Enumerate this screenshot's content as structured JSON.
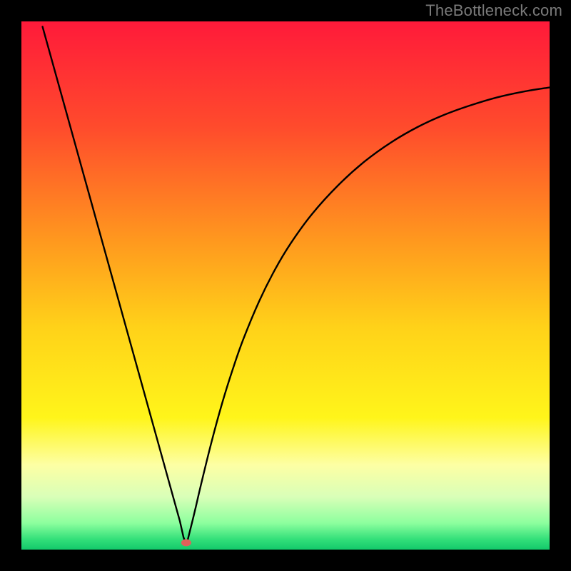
{
  "attribution": "TheBottleneck.com",
  "chart_data": {
    "type": "line",
    "title": "",
    "xlabel": "",
    "ylabel": "",
    "xlim": [
      0,
      100
    ],
    "ylim": [
      0,
      100
    ],
    "gradient_stops": [
      {
        "offset": 0.0,
        "color": "#ff1a3a"
      },
      {
        "offset": 0.2,
        "color": "#ff4b2c"
      },
      {
        "offset": 0.42,
        "color": "#ff9a1e"
      },
      {
        "offset": 0.58,
        "color": "#ffd219"
      },
      {
        "offset": 0.75,
        "color": "#fff51a"
      },
      {
        "offset": 0.84,
        "color": "#fdffa4"
      },
      {
        "offset": 0.9,
        "color": "#d9ffb8"
      },
      {
        "offset": 0.95,
        "color": "#8cff9e"
      },
      {
        "offset": 0.98,
        "color": "#34e07a"
      },
      {
        "offset": 1.0,
        "color": "#13c96b"
      }
    ],
    "marker": {
      "x": 31.2,
      "y": 1.3,
      "color": "#e0615a"
    },
    "series": [
      {
        "name": "bottleneck-curve",
        "x": [
          4,
          6,
          8,
          10,
          12,
          14,
          16,
          18,
          20,
          22,
          24,
          26,
          28,
          29,
          30,
          30.7,
          31,
          31.2,
          31.4,
          31.7,
          32.3,
          33,
          34,
          36,
          38,
          40,
          42,
          45,
          48,
          51,
          55,
          60,
          65,
          70,
          75,
          80,
          85,
          90,
          95,
          100
        ],
        "y": [
          99,
          91.8,
          84.6,
          77.4,
          70.2,
          63.0,
          55.8,
          48.6,
          41.4,
          34.2,
          27.0,
          19.8,
          12.6,
          9.0,
          5.4,
          2.3,
          1.5,
          1.1,
          1.5,
          2.7,
          5.1,
          8.0,
          12.3,
          20.4,
          27.7,
          34.1,
          39.8,
          47.0,
          53.0,
          58.0,
          63.5,
          69.0,
          73.5,
          77.1,
          80.0,
          82.3,
          84.1,
          85.6,
          86.7,
          87.5
        ]
      }
    ]
  }
}
